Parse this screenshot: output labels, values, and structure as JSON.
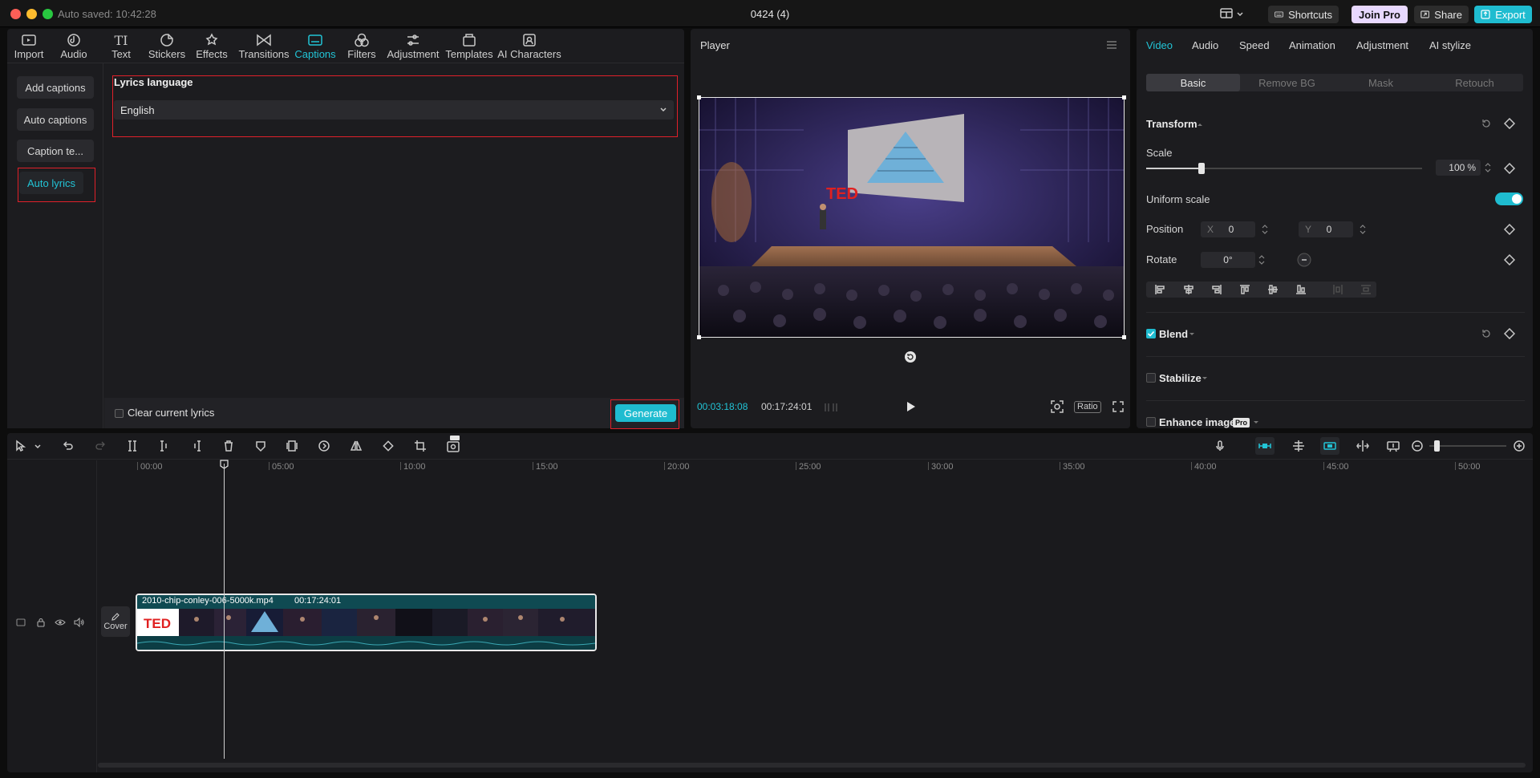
{
  "titlebar": {
    "autosave": "Auto saved: 10:42:28",
    "title": "0424 (4)",
    "shortcuts": "Shortcuts",
    "join_pro": "Join Pro",
    "share": "Share",
    "export": "Export"
  },
  "toolbar": [
    {
      "label": "Import",
      "icon": "import-icon"
    },
    {
      "label": "Audio",
      "icon": "audio-icon"
    },
    {
      "label": "Text",
      "icon": "text-icon"
    },
    {
      "label": "Stickers",
      "icon": "stickers-icon"
    },
    {
      "label": "Effects",
      "icon": "effects-icon"
    },
    {
      "label": "Transitions",
      "icon": "transitions-icon"
    },
    {
      "label": "Captions",
      "icon": "captions-icon",
      "active": true
    },
    {
      "label": "Filters",
      "icon": "filters-icon"
    },
    {
      "label": "Adjustment",
      "icon": "adjustment-icon"
    },
    {
      "label": "Templates",
      "icon": "templates-icon"
    },
    {
      "label": "AI Characters",
      "icon": "ai-characters-icon"
    }
  ],
  "captions": {
    "sidebar": [
      "Add captions",
      "Auto captions",
      "Caption te...",
      "Auto lyrics"
    ],
    "lyrics_language_label": "Lyrics language",
    "lyrics_language_value": "English",
    "clear_label": "Clear current lyrics",
    "generate": "Generate"
  },
  "player": {
    "title": "Player",
    "current_time": "00:03:18:08",
    "total_time": "00:17:24:01",
    "ratio": "Ratio",
    "video_sign": "TED"
  },
  "inspector": {
    "tabs": [
      "Video",
      "Audio",
      "Speed",
      "Animation",
      "Adjustment",
      "AI stylize"
    ],
    "subtabs": [
      "Basic",
      "Remove BG",
      "Mask",
      "Retouch"
    ],
    "transform": "Transform",
    "scale_label": "Scale",
    "scale_value": "100",
    "scale_unit": "%",
    "scale_fraction": 0.2,
    "uniform_scale": "Uniform scale",
    "position_label": "Position",
    "pos_x_label": "X",
    "pos_x": "0",
    "pos_y_label": "Y",
    "pos_y": "0",
    "rotate_label": "Rotate",
    "rotate_value": "0°",
    "blend": "Blend",
    "stabilize": "Stabilize",
    "enhance_image": "Enhance image",
    "pro_badge": "Pro"
  },
  "timeline": {
    "ticks": [
      "00:00",
      "05:00",
      "10:00",
      "15:00",
      "20:00",
      "25:00",
      "30:00",
      "35:00",
      "40:00",
      "45:00",
      "50:00"
    ],
    "clip_name": "2010-chip-conley-006-5000k.mp4",
    "clip_duration": "00:17:24:01",
    "cover": "Cover",
    "thumb_text": "TED"
  },
  "colors": {
    "accent": "#22c4d6",
    "highlight_box": "#e0202a",
    "join_pro_bg": "#e8d8ff"
  }
}
